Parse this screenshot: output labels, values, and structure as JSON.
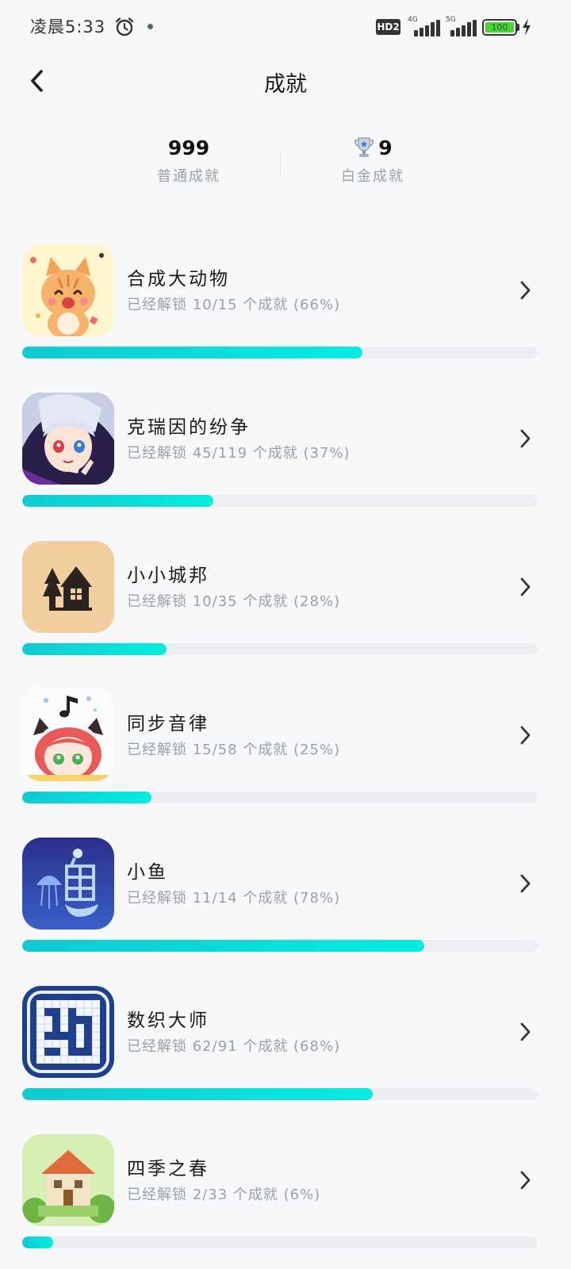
{
  "status_bar": {
    "time": "凌晨5:33",
    "network_badge": "HD2",
    "signal1_tag": "4G",
    "signal2_tag": "5G",
    "battery_level": "100"
  },
  "header": {
    "title": "成就",
    "back_icon": "chevron-left-icon"
  },
  "stats": {
    "normal": {
      "value": "999",
      "label": "普通成就"
    },
    "platinum": {
      "value": "9",
      "label": "白金成就",
      "icon": "trophy-icon"
    }
  },
  "games": [
    {
      "name": "合成大动物",
      "progress_text": "已经解锁 10/15 个成就 (66%)",
      "percent": 0.66
    },
    {
      "name": "克瑞因的纷争",
      "progress_text": "已经解锁 45/119 个成就 (37%)",
      "percent": 0.37
    },
    {
      "name": "小小城邦",
      "progress_text": "已经解锁 10/35 个成就 (28%)",
      "percent": 0.28
    },
    {
      "name": "同步音律",
      "progress_text": "已经解锁 15/58 个成就 (25%)",
      "percent": 0.25
    },
    {
      "name": "小鱼",
      "progress_text": "已经解锁 11/14 个成就 (78%)",
      "percent": 0.78
    },
    {
      "name": "数织大师",
      "progress_text": "已经解锁 62/91 个成就 (68%)",
      "percent": 0.68
    },
    {
      "name": "四季之春",
      "progress_text": "已经解锁 2/33 个成就 (6%)",
      "percent": 0.06
    }
  ],
  "colors": {
    "progress_start": "#12c9d2",
    "progress_end": "#05ecdf",
    "track": "#eceef1"
  }
}
